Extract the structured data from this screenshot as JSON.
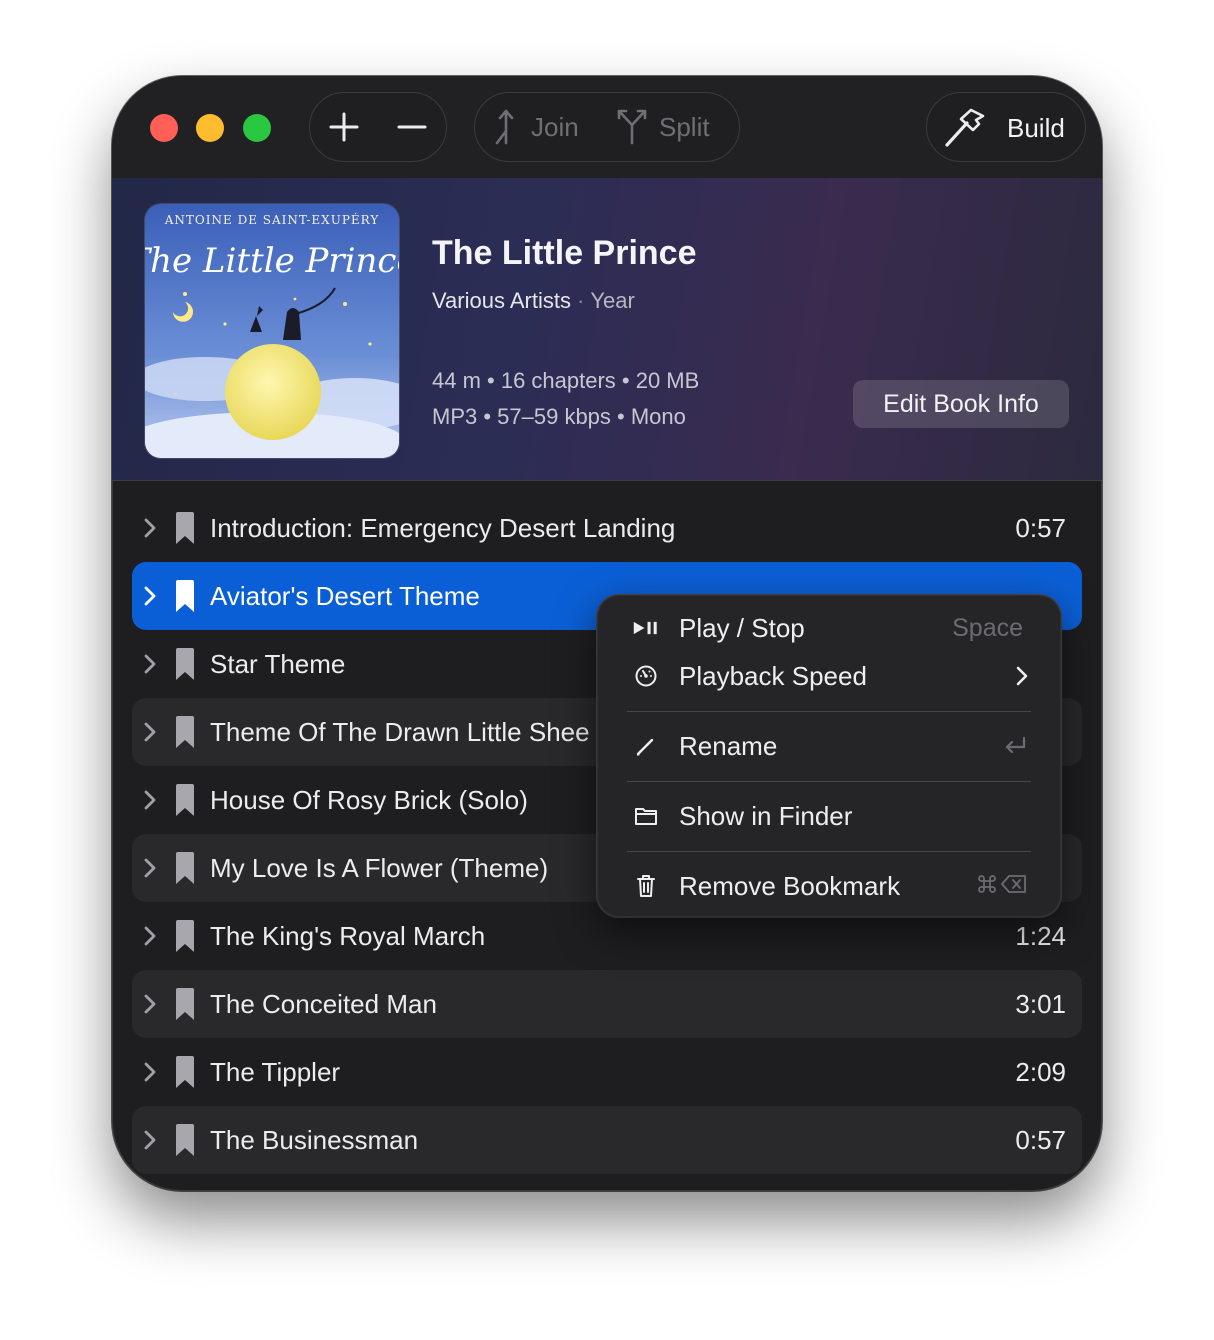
{
  "toolbar": {
    "join_label": "Join",
    "split_label": "Split",
    "build_label": "Build"
  },
  "book": {
    "title": "The Little Prince",
    "artist": "Various Artists",
    "year": "Year",
    "stats": "44 m • 16 chapters • 20 MB",
    "format": "MP3 • 57–59 kbps • Mono",
    "edit_label": "Edit Book Info",
    "cover_author": "ANTOINE DE SAINT-EXUPÉRY",
    "cover_title": "The Little Prince"
  },
  "chapters": [
    {
      "title": "Introduction: Emergency Desert Landing",
      "duration": "0:57"
    },
    {
      "title": "Aviator's Desert Theme",
      "duration": ""
    },
    {
      "title": "Star Theme",
      "duration": ""
    },
    {
      "title": "Theme Of The Drawn Little Shee",
      "duration": ""
    },
    {
      "title": "House Of Rosy Brick (Solo)",
      "duration": ""
    },
    {
      "title": "My Love Is A Flower (Theme)",
      "duration": ""
    },
    {
      "title": "The King's Royal March",
      "duration": "1:24"
    },
    {
      "title": "The Conceited Man",
      "duration": "3:01"
    },
    {
      "title": "The Tippler",
      "duration": "2:09"
    },
    {
      "title": "The Businessman",
      "duration": "0:57"
    }
  ],
  "context_menu": {
    "items": [
      {
        "label": "Play / Stop",
        "shortcut": "Space"
      },
      {
        "label": "Playback Speed",
        "shortcut": ""
      },
      {
        "label": "Rename",
        "shortcut": ""
      },
      {
        "label": "Show in Finder",
        "shortcut": ""
      },
      {
        "label": "Remove Bookmark",
        "shortcut": ""
      }
    ]
  },
  "colors": {
    "selection": "#0b5fd6",
    "window_bg": "#1e1e20",
    "close": "#ff5f57",
    "minimize": "#febc2e",
    "zoom": "#28c840"
  }
}
